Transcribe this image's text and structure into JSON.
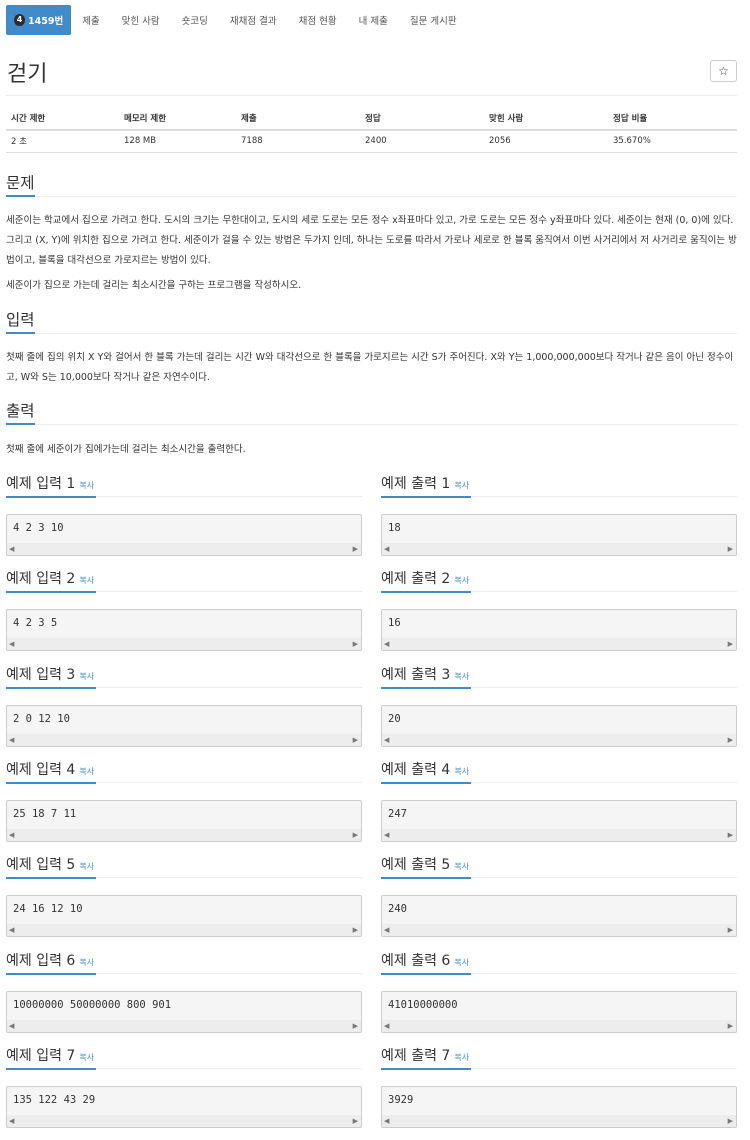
{
  "nav": {
    "level_badge": "4",
    "items": [
      "1459번",
      "제출",
      "맞힌 사람",
      "숏코딩",
      "재채점 결과",
      "채점 현황",
      "내 제출",
      "질문 게시판"
    ]
  },
  "problem": {
    "title": "걷기",
    "star": "☆"
  },
  "info": {
    "headers": [
      "시간 제한",
      "메모리 제한",
      "제출",
      "정답",
      "맞힌 사람",
      "정답 비율"
    ],
    "values": [
      "2 초",
      "128 MB",
      "7188",
      "2400",
      "2056",
      "35.670%"
    ]
  },
  "sections": {
    "problem_heading": "문제",
    "problem_p1": "세준이는 학교에서 집으로 가려고 한다. 도시의 크기는 무한대이고, 도시의 세로 도로는 모든 정수 x좌표마다 있고, 가로 도로는 모든 정수 y좌표마다 있다. 세준이는 현재 (0, 0)에 있다. 그리고 (X, Y)에 위치한 집으로 가려고 한다. 세준이가 걸을 수 있는 방법은 두가지 인데, 하나는 도로를 따라서 가로나 세로로 한 블록 움직여서 이번 사거리에서 저 사거리로 움직이는 방법이고, 블록을 대각선으로 가로지르는 방법이 있다.",
    "problem_p2": "세준이가 집으로 가는데 걸리는 최소시간을 구하는 프로그램을 작성하시오.",
    "input_heading": "입력",
    "input_p": "첫째 줄에 집의 위치 X Y와 걸어서 한 블록 가는데 걸리는 시간 W와 대각선으로 한 블록을 가로지르는 시간 S가 주어진다. X와 Y는 1,000,000,000보다 작거나 같은 음이 아닌 정수이고, W와 S는 10,000보다 작거나 같은 자연수이다.",
    "output_heading": "출력",
    "output_p": "첫째 줄에 세준이가 집에가는데 걸리는 최소시간을 출력한다."
  },
  "examples": {
    "copy_label": "복사",
    "items": [
      {
        "in_label": "예제 입력 1",
        "out_label": "예제 출력 1",
        "input": "4 2 3 10",
        "output": "18"
      },
      {
        "in_label": "예제 입력 2",
        "out_label": "예제 출력 2",
        "input": "4 2 3 5",
        "output": "16"
      },
      {
        "in_label": "예제 입력 3",
        "out_label": "예제 출력 3",
        "input": "2 0 12 10",
        "output": "20"
      },
      {
        "in_label": "예제 입력 4",
        "out_label": "예제 출력 4",
        "input": "25 18 7 11",
        "output": "247"
      },
      {
        "in_label": "예제 입력 5",
        "out_label": "예제 출력 5",
        "input": "24 16 12 10",
        "output": "240"
      },
      {
        "in_label": "예제 입력 6",
        "out_label": "예제 출력 6",
        "input": "10000000 50000000 800 901",
        "output": "41010000000"
      },
      {
        "in_label": "예제 입력 7",
        "out_label": "예제 출력 7",
        "input": "135 122 43 29",
        "output": "3929"
      }
    ]
  }
}
